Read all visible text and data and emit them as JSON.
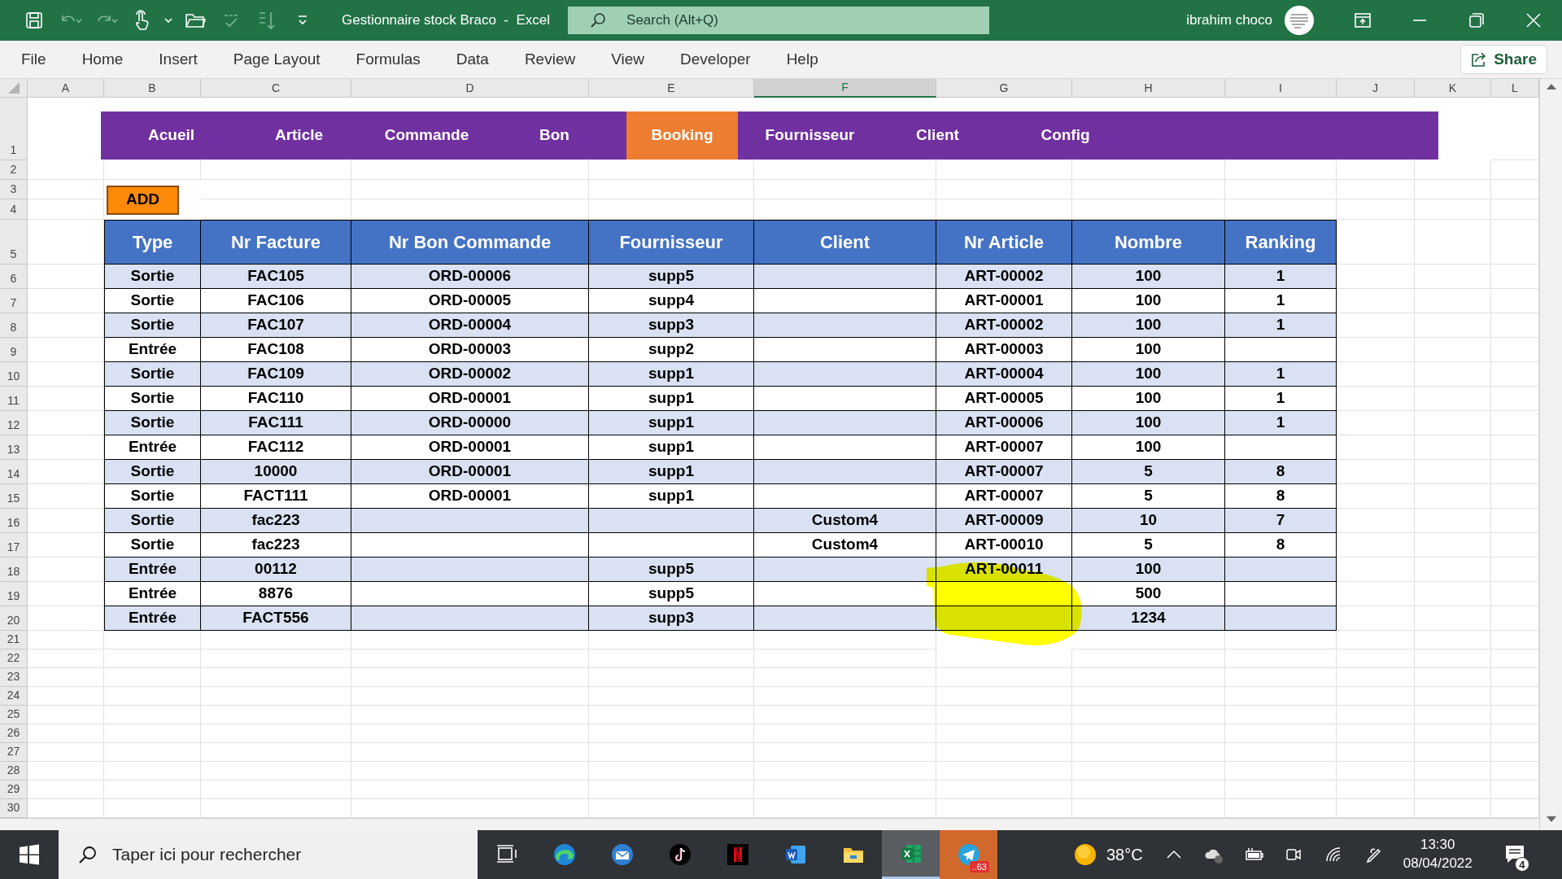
{
  "window": {
    "title": "Gestionnaire stock Braco  -  Excel",
    "search_placeholder": "Search (Alt+Q)",
    "user": "ibrahim choco"
  },
  "ribbon": {
    "tabs": [
      {
        "label": "File"
      },
      {
        "label": "Home"
      },
      {
        "label": "Insert"
      },
      {
        "label": "Page Layout"
      },
      {
        "label": "Formulas"
      },
      {
        "label": "Data"
      },
      {
        "label": "Review"
      },
      {
        "label": "View"
      },
      {
        "label": "Developer"
      },
      {
        "label": "Help"
      }
    ],
    "share": "Share"
  },
  "sheet": {
    "column_letters": [
      {
        "label": "A",
        "selected": false
      },
      {
        "label": "B",
        "selected": false
      },
      {
        "label": "C",
        "selected": false
      },
      {
        "label": "D",
        "selected": false
      },
      {
        "label": "E",
        "selected": false
      },
      {
        "label": "F",
        "selected": true
      },
      {
        "label": "G",
        "selected": false
      },
      {
        "label": "H",
        "selected": false
      },
      {
        "label": "I",
        "selected": false
      },
      {
        "label": "J",
        "selected": false
      },
      {
        "label": "K",
        "selected": false
      },
      {
        "label": "L",
        "selected": false
      }
    ],
    "row_numbers": [
      "1",
      "2",
      "3",
      "4",
      "5",
      "6",
      "7",
      "8",
      "9",
      "10",
      "11",
      "12",
      "13",
      "14",
      "15",
      "16",
      "17",
      "18",
      "19",
      "20",
      "21",
      "22",
      "23",
      "24",
      "25",
      "26",
      "27",
      "28",
      "29",
      "30"
    ]
  },
  "nav": [
    {
      "label": "Acueil",
      "selected": false
    },
    {
      "label": "Article",
      "selected": false
    },
    {
      "label": "Commande",
      "selected": false
    },
    {
      "label": "Bon",
      "selected": false
    },
    {
      "label": "Booking",
      "selected": true
    },
    {
      "label": "Fournisseur",
      "selected": false
    },
    {
      "label": "Client",
      "selected": false
    },
    {
      "label": "Config",
      "selected": false
    }
  ],
  "add_button": "ADD",
  "table": {
    "columns": [
      "Type",
      "Nr Facture",
      "Nr Bon Commande",
      "Fournisseur",
      "Client",
      "Nr Article",
      "Nombre",
      "Ranking"
    ],
    "rows": [
      {
        "cells": [
          {
            "text": "Sortie"
          },
          {
            "text": "FAC105"
          },
          {
            "text": "ORD-00006"
          },
          {
            "text": "supp5"
          },
          {},
          {
            "text": "ART-00002"
          },
          {
            "text": "100"
          },
          {
            "text": "1"
          }
        ]
      },
      {
        "cells": [
          {
            "text": "Sortie"
          },
          {
            "text": "FAC106"
          },
          {
            "text": "ORD-00005"
          },
          {
            "text": "supp4"
          },
          {},
          {
            "text": "ART-00001"
          },
          {
            "text": "100"
          },
          {
            "text": "1"
          }
        ]
      },
      {
        "cells": [
          {
            "text": "Sortie"
          },
          {
            "text": "FAC107"
          },
          {
            "text": "ORD-00004"
          },
          {
            "text": "supp3"
          },
          {},
          {
            "text": "ART-00002"
          },
          {
            "text": "100"
          },
          {
            "text": "1"
          }
        ]
      },
      {
        "cells": [
          {
            "text": "Entrée"
          },
          {
            "text": "FAC108"
          },
          {
            "text": "ORD-00003"
          },
          {
            "text": "supp2"
          },
          {},
          {
            "text": "ART-00003"
          },
          {
            "text": "100"
          },
          {}
        ]
      },
      {
        "cells": [
          {
            "text": "Sortie"
          },
          {
            "text": "FAC109"
          },
          {
            "text": "ORD-00002"
          },
          {
            "text": "supp1"
          },
          {},
          {
            "text": "ART-00004"
          },
          {
            "text": "100"
          },
          {
            "text": "1"
          }
        ]
      },
      {
        "cells": [
          {
            "text": "Sortie"
          },
          {
            "text": "FAC110"
          },
          {
            "text": "ORD-00001"
          },
          {
            "text": "supp1"
          },
          {},
          {
            "text": "ART-00005"
          },
          {
            "text": "100"
          },
          {
            "text": "1"
          }
        ]
      },
      {
        "cells": [
          {
            "text": "Sortie"
          },
          {
            "text": "FAC111"
          },
          {
            "text": "ORD-00000"
          },
          {
            "text": "supp1"
          },
          {},
          {
            "text": "ART-00006"
          },
          {
            "text": "100"
          },
          {
            "text": "1"
          }
        ]
      },
      {
        "cells": [
          {
            "text": "Entrée"
          },
          {
            "text": "FAC112"
          },
          {
            "text": "ORD-00001"
          },
          {
            "text": "supp1"
          },
          {},
          {
            "text": "ART-00007"
          },
          {
            "text": "100"
          },
          {}
        ]
      },
      {
        "cells": [
          {
            "text": "Sortie"
          },
          {
            "text": "10000"
          },
          {
            "text": "ORD-00001"
          },
          {
            "text": "supp1"
          },
          {},
          {
            "text": "ART-00007"
          },
          {
            "text": "5"
          },
          {
            "text": "8"
          }
        ]
      },
      {
        "cells": [
          {
            "text": "Sortie"
          },
          {
            "text": "FACT111"
          },
          {
            "text": "ORD-00001"
          },
          {
            "text": "supp1"
          },
          {},
          {
            "text": "ART-00007"
          },
          {
            "text": "5"
          },
          {
            "text": "8"
          }
        ]
      },
      {
        "cells": [
          {
            "text": "Sortie"
          },
          {
            "text": "fac223"
          },
          {},
          {},
          {
            "text": "Custom4"
          },
          {
            "text": "ART-00009"
          },
          {
            "text": "10"
          },
          {
            "text": "7"
          }
        ]
      },
      {
        "cells": [
          {
            "text": "Sortie"
          },
          {
            "text": "fac223"
          },
          {},
          {},
          {
            "text": "Custom4"
          },
          {
            "text": "ART-00010"
          },
          {
            "text": "5"
          },
          {
            "text": "8"
          }
        ]
      },
      {
        "cells": [
          {
            "text": "Entrée"
          },
          {
            "text": "00112"
          },
          {},
          {
            "text": "supp5"
          },
          {},
          {
            "text": "ART-00011"
          },
          {
            "text": "100"
          },
          {}
        ]
      },
      {
        "cells": [
          {
            "text": "Entrée"
          },
          {
            "text": "8876"
          },
          {},
          {
            "text": "supp5"
          },
          {},
          {},
          {
            "text": "500"
          },
          {}
        ]
      },
      {
        "cells": [
          {
            "text": "Entrée"
          },
          {
            "text": "FACT556"
          },
          {},
          {
            "text": "supp3"
          },
          {},
          {},
          {
            "text": "1234"
          },
          {}
        ]
      }
    ]
  },
  "taskbar": {
    "search_placeholder": "Taper ici pour rechercher",
    "apps": [
      {
        "active": false,
        "flashing": false
      },
      {
        "active": false,
        "flashing": false
      },
      {
        "active": false,
        "flashing": false
      },
      {
        "active": false,
        "flashing": false
      },
      {
        "active": false,
        "flashing": false
      },
      {
        "active": false,
        "flashing": false
      },
      {
        "active": false,
        "flashing": false
      },
      {
        "active": true,
        "flashing": false
      },
      {
        "active": false,
        "flashing": true,
        "badge": "..63"
      }
    ],
    "weather": "38°C",
    "time": "13:30",
    "date": "08/04/2022",
    "notifications": "4"
  }
}
